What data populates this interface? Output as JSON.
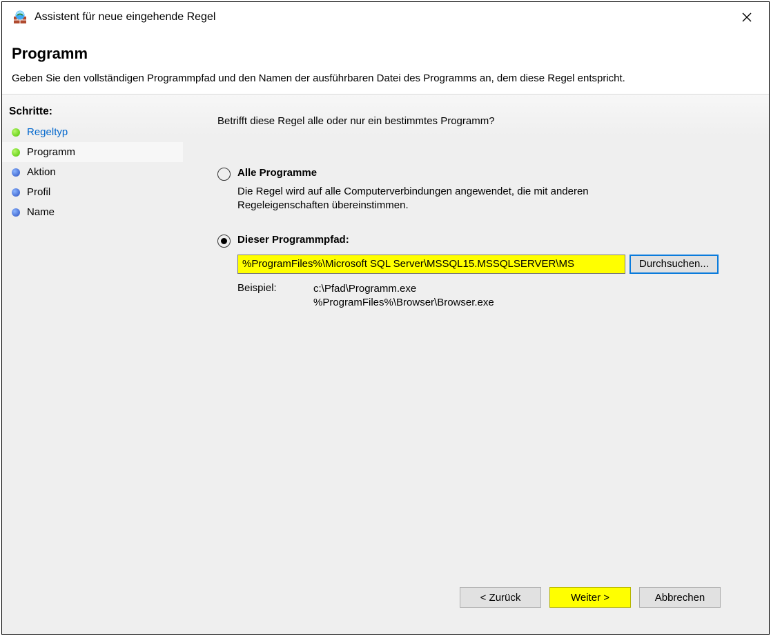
{
  "window": {
    "title": "Assistent für neue eingehende Regel"
  },
  "header": {
    "title": "Programm",
    "subtitle": "Geben Sie den vollständigen Programmpfad und den Namen der ausführbaren Datei des Programms an, dem diese Regel entspricht."
  },
  "sidebar": {
    "heading": "Schritte:",
    "steps": [
      {
        "label": "Regeltyp",
        "bullet": "green",
        "link": true
      },
      {
        "label": "Programm",
        "bullet": "green",
        "link": false
      },
      {
        "label": "Aktion",
        "bullet": "blue",
        "link": false
      },
      {
        "label": "Profil",
        "bullet": "blue",
        "link": false
      },
      {
        "label": "Name",
        "bullet": "blue",
        "link": false
      }
    ]
  },
  "content": {
    "question": "Betrifft diese Regel alle oder nur ein bestimmtes Programm?",
    "optionAll": {
      "label": "Alle Programme",
      "desc": "Die Regel wird auf alle Computerverbindungen angewendet, die mit anderen Regeleigenschaften übereinstimmen."
    },
    "optionPath": {
      "label": "Dieser Programmpfad:",
      "value": "%ProgramFiles%\\Microsoft SQL Server\\MSSQL15.MSSQLSERVER\\MS",
      "browse": "Durchsuchen...",
      "exampleLabel": "Beispiel:",
      "exampleText": "c:\\Pfad\\Programm.exe\n%ProgramFiles%\\Browser\\Browser.exe"
    }
  },
  "footer": {
    "back": "< Zurück",
    "next": "Weiter >",
    "cancel": "Abbrechen"
  }
}
